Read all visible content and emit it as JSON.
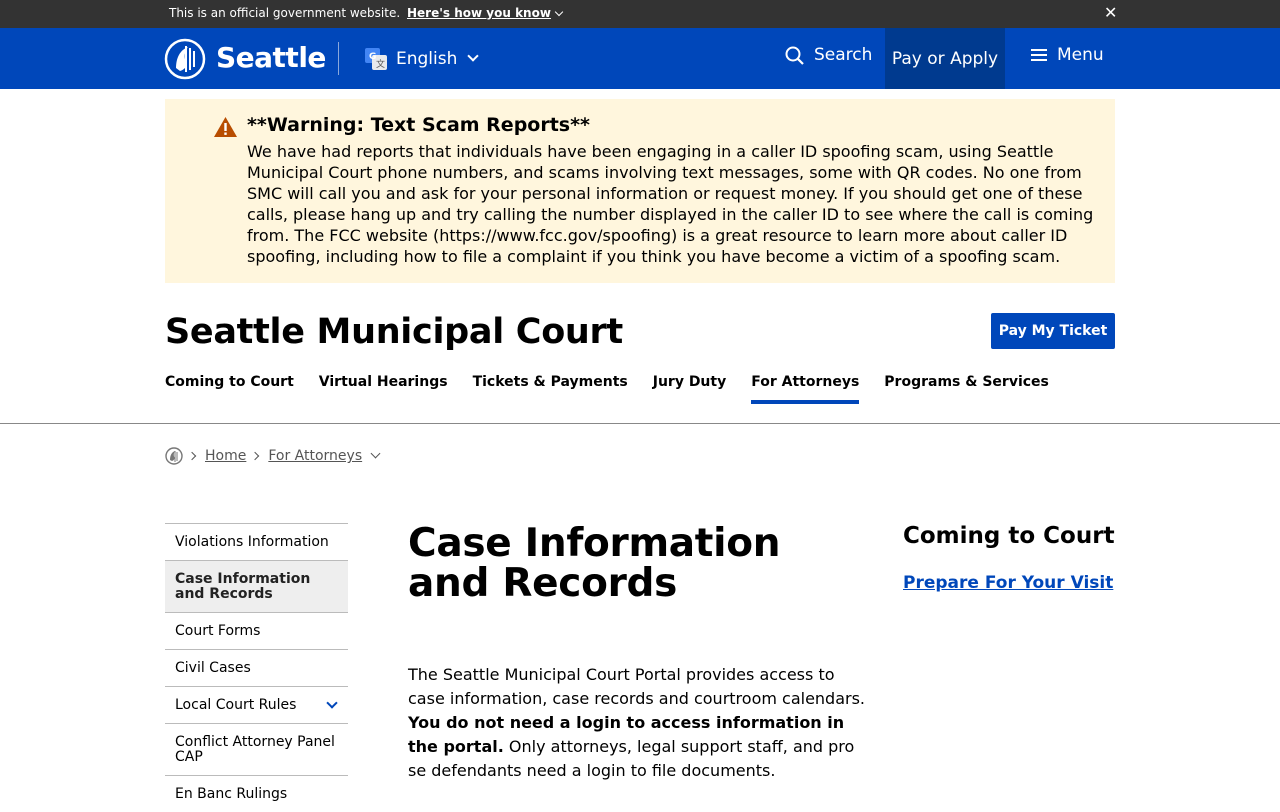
{
  "gov_banner": {
    "text": "This is an official government website.",
    "link": "Here's how you know",
    "close": "✕"
  },
  "header": {
    "brand": "Seattle",
    "language": "English",
    "search": "Search",
    "pay_apply": "Pay or Apply",
    "menu": "Menu"
  },
  "alert": {
    "title": "**Warning: Text Scam Reports**",
    "body": "We have had reports that individuals have been engaging in a caller ID spoofing scam, using Seattle Municipal Court phone numbers, and scams involving text messages, some with QR codes. No one from SMC will call you and ask for your personal information or request money. If you should get one of these calls, please hang up and try calling the number displayed in the caller ID to see where the call is coming from. The FCC website (https://www.fcc.gov/spoofing) is a great resource to learn more about caller ID spoofing, including how to file a complaint if you think you have become a victim of a spoofing scam."
  },
  "site": {
    "title": "Seattle Municipal Court",
    "pay_ticket": "Pay My Ticket"
  },
  "nav": {
    "items": [
      "Coming to Court",
      "Virtual Hearings",
      "Tickets & Payments",
      "Jury Duty",
      "For Attorneys",
      "Programs & Services"
    ]
  },
  "breadcrumb": {
    "home": "Home",
    "current": "For Attorneys"
  },
  "sidenav": {
    "items": [
      "Violations Information",
      "Case Information and Records",
      "Court Forms",
      "Civil Cases",
      "Local Court Rules",
      "Conflict Attorney Panel CAP",
      "En Banc Rulings"
    ]
  },
  "main": {
    "title": "Case Information and Records",
    "intro_1": "The Seattle Municipal Court Portal provides access to case information, case records and courtroom calendars.",
    "intro_bold": "You do not need a login to access information in the portal.",
    "intro_2": "Only attorneys, legal support staff, and pro se defendants need a login to file documents."
  },
  "aside": {
    "title": "Coming to Court",
    "link": "Prepare For Your Visit"
  },
  "colors": {
    "brand_blue": "#0047ba",
    "dark_blue": "#003a8f",
    "alert_bg": "#fff6dd",
    "warn": "#b84d00"
  }
}
